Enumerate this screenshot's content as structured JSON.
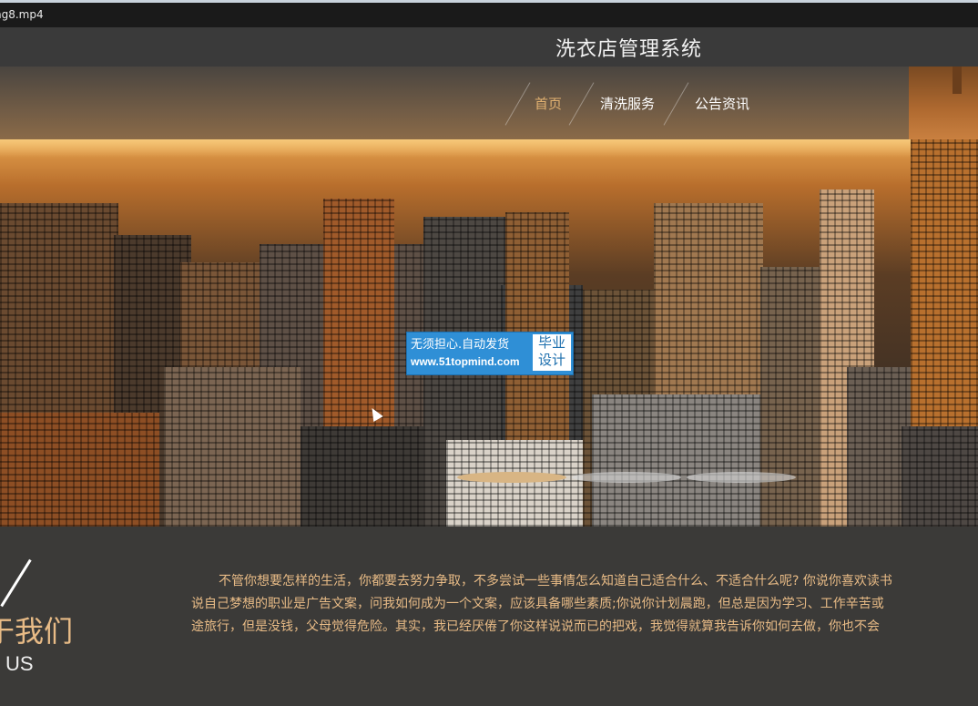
{
  "window": {
    "title": "ng8.mp4"
  },
  "site": {
    "title": "洗衣店管理系统"
  },
  "nav": {
    "items": [
      "首页",
      "清洗服务",
      "公告资讯"
    ],
    "active_index": 0
  },
  "watermark": {
    "line1": "无须担心.自动发货",
    "line2": "www.51topmind.com",
    "badge": "毕业\n设计"
  },
  "about": {
    "title": "于我们",
    "subtitle": "US",
    "lines": [
      "不管你想要怎样的生活，你都要去努力争取，不多尝试一些事情怎么知道自己适合什么、不适合什么呢? 你说你喜欢读书",
      "说自己梦想的职业是广告文案，问我如何成为一个文案，应该具备哪些素质;你说你计划晨跑，但总是因为学习、工作辛苦或",
      "途旅行，但是没钱，父母觉得危险。其实，我已经厌倦了你这样说说而已的把戏，我觉得就算我告诉你如何去做，你也不会"
    ]
  },
  "colors": {
    "accent": "#e8bb86",
    "nav_active": "#e0b070",
    "header_bg": "#3a3a3a",
    "watermark_blue": "#2f8fd6"
  },
  "carousel": {
    "slide_count": 3,
    "active_index": 0
  }
}
